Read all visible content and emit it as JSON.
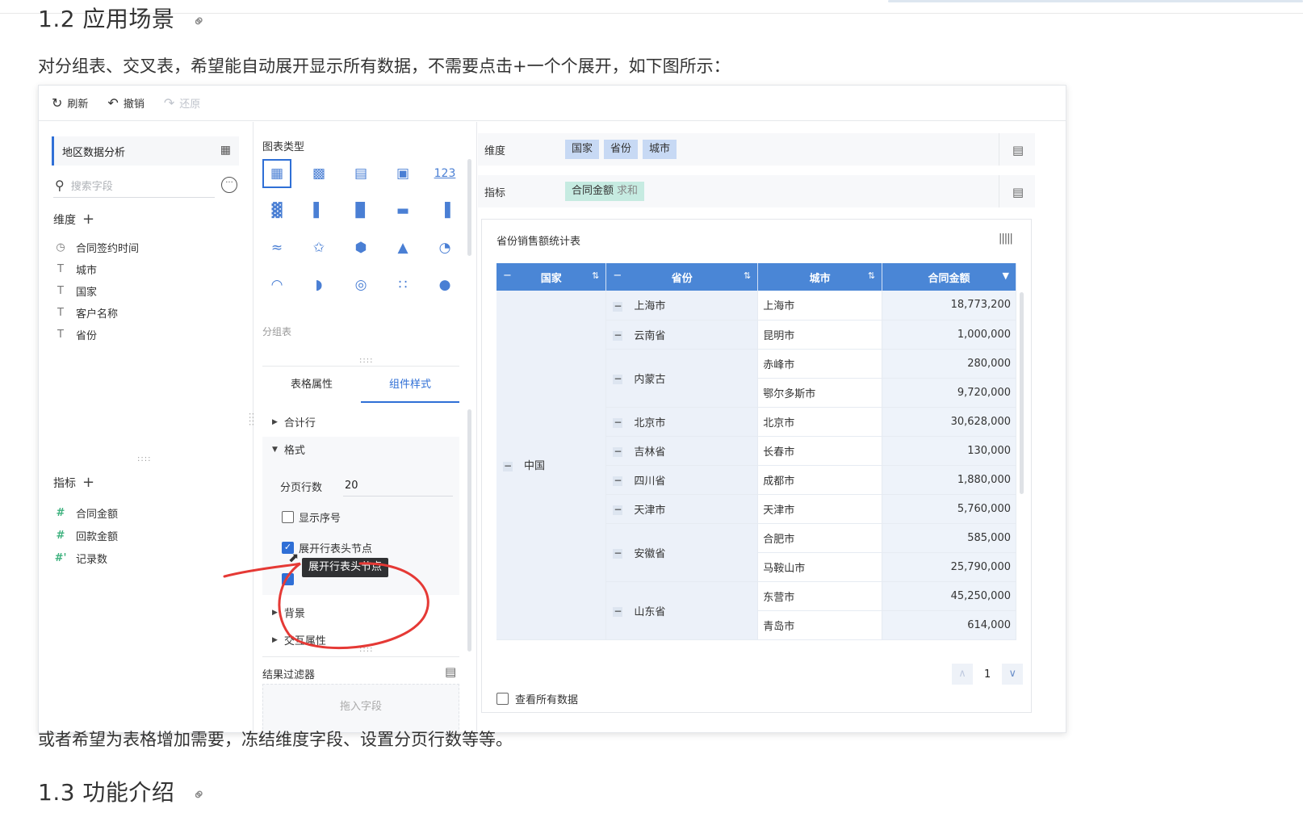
{
  "doc": {
    "heading_prev": "1.2 应用场景",
    "intro": "对分组表、交叉表，希望能自动展开显示所有数据，不需要点击+一个个展开，如下图所示：",
    "after": "或者希望为表格增加需要，冻结维度字段、设置分页行数等等。",
    "heading_next": "1.3 功能介绍"
  },
  "toolbar": {
    "refresh": "刷新",
    "undo": "撤销",
    "redo": "还原"
  },
  "left": {
    "dataset": "地区数据分析",
    "search_placeholder": "搜索字段",
    "dimensions_title": "维度",
    "dimensions": [
      {
        "icon": "clock-icon",
        "label": "合同签约时间"
      },
      {
        "icon": "text-type-icon",
        "label": "城市"
      },
      {
        "icon": "text-type-icon",
        "label": "国家"
      },
      {
        "icon": "text-type-icon",
        "label": "客户名称"
      },
      {
        "icon": "text-type-icon",
        "label": "省份"
      }
    ],
    "measures_title": "指标",
    "measures": [
      {
        "icon": "number-type-icon",
        "label": "合同金额"
      },
      {
        "icon": "number-type-icon",
        "label": "回款金额"
      },
      {
        "icon": "calc-number-icon",
        "label": "记录数"
      }
    ]
  },
  "mid": {
    "chart_type_title": "图表类型",
    "chart_type_selected_label": "分组表",
    "tab_table_props": "表格属性",
    "tab_component_style": "组件样式",
    "total_row": "合计行",
    "format": "格式",
    "rows_per_page_label": "分页行数",
    "rows_per_page_value": "20",
    "show_serial": "显示序号",
    "show_serial_checked": false,
    "expand_header_nodes": "展开行表头节点",
    "expand_header_nodes_checked": true,
    "tooltip": "展开行表头节点",
    "background": "背景",
    "interaction": "交互属性",
    "result_filter": "结果过滤器",
    "drop_field": "拖入字段"
  },
  "right": {
    "dim_label": "维度",
    "dim_pills": [
      "国家",
      "省份",
      "城市"
    ],
    "measure_label": "指标",
    "measure_pill": "合同金额",
    "measure_agg": "求和",
    "chart_title": "省份销售额统计表",
    "headers": [
      "国家",
      "省份",
      "城市",
      "合同金额"
    ],
    "country": "中国",
    "groups": [
      {
        "province": "上海市",
        "cities": [
          [
            "上海市",
            "18,773,200"
          ]
        ]
      },
      {
        "province": "云南省",
        "cities": [
          [
            "昆明市",
            "1,000,000"
          ]
        ]
      },
      {
        "province": "内蒙古",
        "cities": [
          [
            "赤峰市",
            "280,000"
          ],
          [
            "鄂尔多斯市",
            "9,720,000"
          ]
        ]
      },
      {
        "province": "北京市",
        "cities": [
          [
            "北京市",
            "30,628,000"
          ]
        ]
      },
      {
        "province": "吉林省",
        "cities": [
          [
            "长春市",
            "130,000"
          ]
        ]
      },
      {
        "province": "四川省",
        "cities": [
          [
            "成都市",
            "1,880,000"
          ]
        ]
      },
      {
        "province": "天津市",
        "cities": [
          [
            "天津市",
            "5,760,000"
          ]
        ]
      },
      {
        "province": "安徽省",
        "cities": [
          [
            "合肥市",
            "585,000"
          ],
          [
            "马鞍山市",
            "25,790,000"
          ]
        ]
      },
      {
        "province": "山东省",
        "cities": [
          [
            "东营市",
            "45,250,000"
          ],
          [
            "青岛市",
            "614,000"
          ]
        ]
      }
    ],
    "page": "1",
    "view_all": "查看所有数据"
  }
}
